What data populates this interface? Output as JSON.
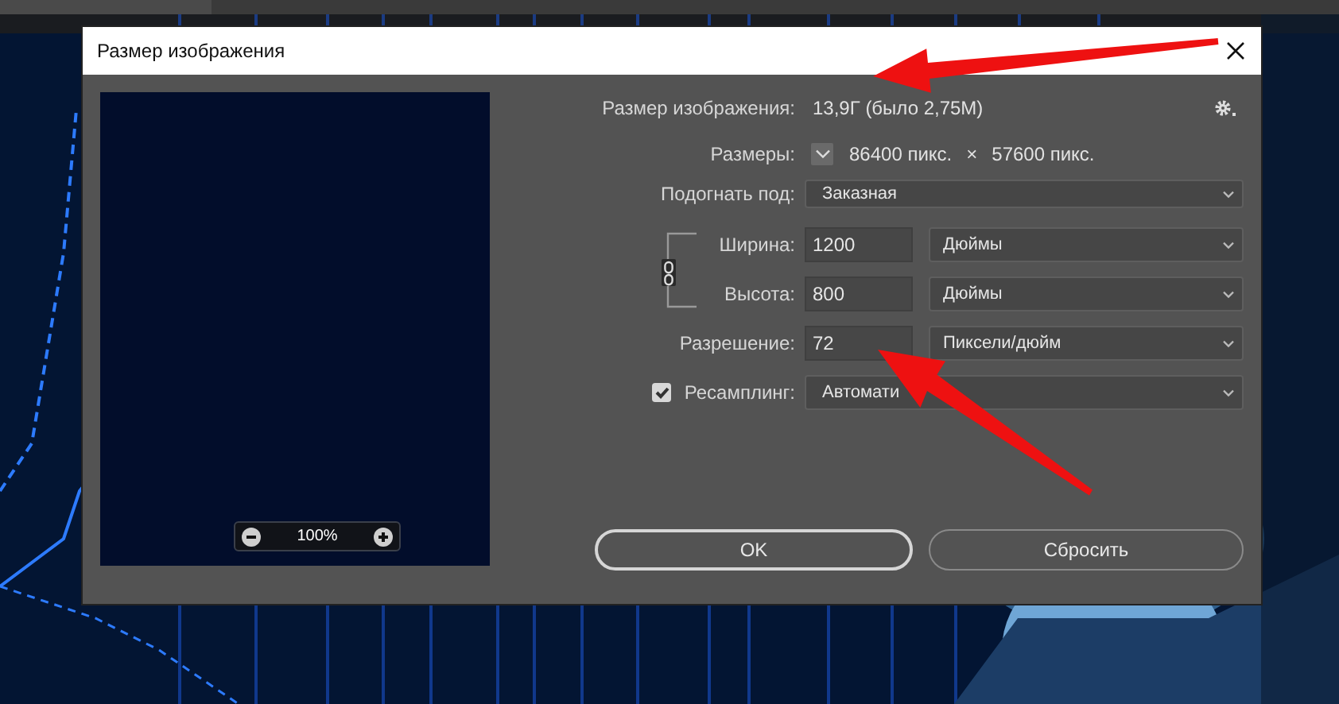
{
  "window": {
    "title": "Размер изображения"
  },
  "preview": {
    "zoom": "100%"
  },
  "image_size": {
    "label": "Размер изображения:",
    "value": "13,9Г (было 2,75М)"
  },
  "dimensions": {
    "label": "Размеры:",
    "width": "86400 пикс.",
    "separator": "×",
    "height": "57600 пикс."
  },
  "fit_to": {
    "label": "Подогнать под:",
    "value": "Заказная"
  },
  "constrain_proportions": {
    "on": true
  },
  "fields": [
    {
      "label": "Ширина:",
      "value": "1200",
      "unit": "Дюймы"
    },
    {
      "label": "Высота:",
      "value": "800",
      "unit": "Дюймы"
    },
    {
      "label": "Разрешение:",
      "value": "72",
      "unit": "Пиксели/дюйм"
    }
  ],
  "resample": {
    "label": "Ресамплинг:",
    "checked": true,
    "value": "Автомати"
  },
  "buttons": [
    {
      "label": "OK",
      "default": true
    },
    {
      "label": "Сбросить",
      "default": false
    }
  ]
}
